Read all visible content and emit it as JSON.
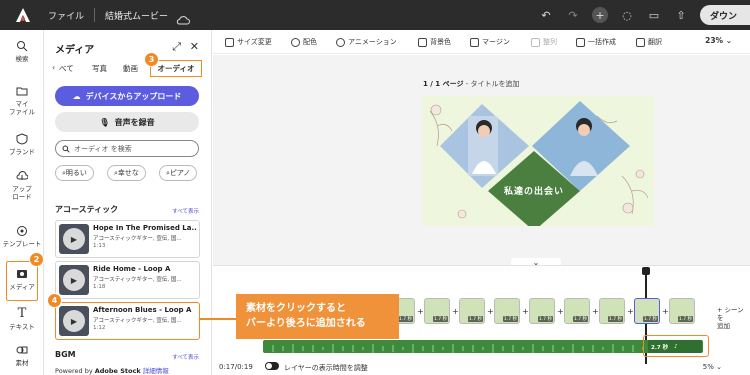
{
  "topbar": {
    "file_label": "ファイル",
    "project_title": "結婚式ムービー",
    "download_label": "ダウン"
  },
  "leftnav": {
    "items": [
      {
        "label": "検索",
        "icon": "search-icon"
      },
      {
        "label": "マイ\nファイル",
        "icon": "folder-icon"
      },
      {
        "label": "ブランド",
        "icon": "brand-icon"
      },
      {
        "label": "アップ\nロード",
        "icon": "upload-icon"
      },
      {
        "label": "テンプレート",
        "icon": "template-icon"
      },
      {
        "label": "メディア",
        "icon": "media-icon"
      },
      {
        "label": "テキスト",
        "icon": "text-icon"
      },
      {
        "label": "素材",
        "icon": "elements-icon"
      }
    ]
  },
  "panel": {
    "title": "メディア",
    "tabs": [
      "べて",
      "写真",
      "動画",
      "オーディオ"
    ],
    "upload_button": "デバイスからアップロード",
    "record_button": "音声を録音",
    "search_placeholder": "オーディオ を検索",
    "chips": [
      "明るい",
      "幸せな",
      "ピアノ"
    ],
    "section_acoustic": "アコースティック",
    "view_all": "すべて表示",
    "tracks": [
      {
        "title": "Hope In The Promised La...",
        "meta": "アコースティックギター, 宣伝, 国...",
        "duration": "1:13"
      },
      {
        "title": "Ride Home - Loop A",
        "meta": "アコースティックギター, 宣伝, 国...",
        "duration": "1:18"
      },
      {
        "title": "Afternoon Blues - Loop A",
        "meta": "アコースティックギター, 宣伝, 国...",
        "duration": "1:12"
      }
    ],
    "section_bgm": "BGM",
    "powered_prefix": "Powered by ",
    "powered_brand": "Adobe Stock",
    "powered_link": "詳細情報"
  },
  "badges": [
    "2",
    "3",
    "4"
  ],
  "toolbar": {
    "items": [
      "サイズ変更",
      "配色",
      "アニメーション",
      "背景色",
      "マージン",
      "整列",
      "一括作成",
      "翻訳"
    ],
    "zoom": "23%"
  },
  "canvas": {
    "page_label_bold": "1 / 1 ページ",
    "page_label_rest": " - タイトルを追加",
    "slide_text": "私達の出会い"
  },
  "timeline": {
    "clip_durations": [
      "1.7 秒",
      "1.7 秒",
      "1.7 秒",
      "1.7 秒",
      "1.7 秒",
      "1.7 秒",
      "1.7 秒",
      "1.7 秒",
      "1.7 秒"
    ],
    "add_scene": "+ シーンを\n追加",
    "audio_clip_label": "2.7 秒",
    "time": "0:17/0:19",
    "toggle_label": "レイヤーの表示時間を調整",
    "zoom": "5%"
  },
  "callout": {
    "line1": "素材をクリックすると",
    "line2": "バーより後ろに追加される"
  },
  "colors": {
    "accent": "#5c5ce0",
    "highlight": "#f08a24",
    "callout": "#f0923a",
    "audio": "#3d8a3d",
    "slide_bg": "#eef6dd",
    "diamond_green": "#4a7f3f"
  }
}
